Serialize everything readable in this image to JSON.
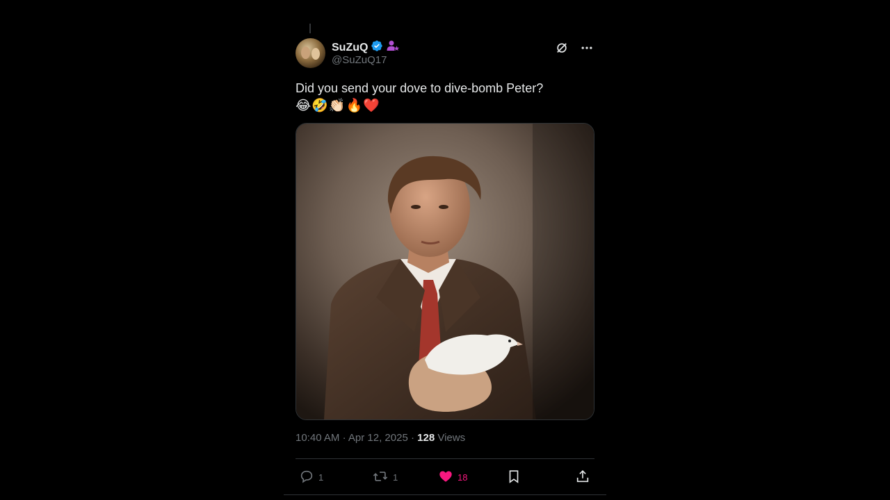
{
  "tweet": {
    "author": {
      "display_name": "SuZuQ",
      "handle": "@SuZuQ17",
      "verified": true,
      "badge_icon": "affiliate-person-star-icon"
    },
    "text": "Did you send your dove to dive-bomb Peter?",
    "emojis": [
      "😂",
      "🤣",
      "👏🏻",
      "🔥",
      "❤️"
    ],
    "media_alt": "Vintage portrait photo of a man in a brown suit and red tie holding a white dove",
    "time": "10:40 AM",
    "separator": "·",
    "date": "Apr 12, 2025",
    "views_count": "128",
    "views_label": "Views"
  },
  "actions": {
    "replies": "1",
    "reposts": "1",
    "likes": "18",
    "liked": true
  },
  "colors": {
    "background": "#000000",
    "text": "#e7e9ea",
    "muted": "#71767b",
    "verified": "#1d9bf0",
    "like": "#f91880",
    "badge": "#b14fd2"
  }
}
